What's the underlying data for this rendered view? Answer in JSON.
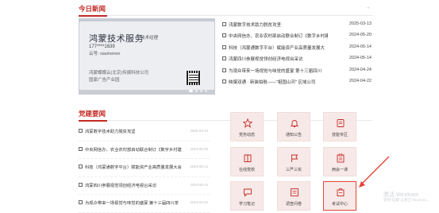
{
  "sections": {
    "news_title": "今日新闻",
    "party_title": "党建要闻",
    "more_symbol": "→"
  },
  "card": {
    "name": "鸿蒙技术服务",
    "role": "技术经理",
    "phone": "177****1639",
    "id_line": "云号: xiaoheiren",
    "company": "鸿蒙蝶蝶云(北京)传媒科技公司",
    "park": "国家广告产业园"
  },
  "news": [
    {
      "title": "鸿蒙数字技术助力脱贫攻坚",
      "date": "2025-03-13"
    },
    {
      "title": "中央网信办、农业农村部启动联合制订《数字乡村建",
      "date": "2024-05-20"
    },
    {
      "title": "科技（鸿蒙通数字平台）赋能资产业高质量发展大",
      "date": "2024-05-14"
    },
    {
      "title": "鸿蒙四川参展视觉领创经济电视台采访",
      "date": "2024-05-14"
    },
    {
      "title": "为观众带来一场视觉与味觉的盛宴 第十三届四川",
      "date": "2024-04-24"
    },
    {
      "title": "映爆双通 · 新装拍航——\"祖国山河\" 区域公司",
      "date": "2024-04-22"
    }
  ],
  "party_news": [
    {
      "title": "鸿蒙数字技术助力脱贫攻坚",
      "date": "2025-03-13"
    },
    {
      "title": "中央网信办、农业农村部启动联合制订《数字乡村建",
      "date": "2024-05-20"
    },
    {
      "title": "科技（鸿蒙通数字平台）赋能资产业高质量发展大会",
      "date": "2024-05-14"
    },
    {
      "title": "鸿蒙四川参展视觉领创经济电视台采访",
      "date": "2024-05-14"
    },
    {
      "title": "为观众带来一场视觉与味觉的盛宴 第十三届四川茶",
      "date": "2024-04-24"
    }
  ],
  "tiles": [
    {
      "label": "党务动态",
      "icon": "star-icon"
    },
    {
      "label": "通知公告",
      "icon": "bell-icon"
    },
    {
      "label": "技能专区",
      "icon": "badge-icon"
    },
    {
      "label": "在线党校",
      "icon": "book-icon"
    },
    {
      "label": "三严三实",
      "icon": "flag-icon"
    },
    {
      "label": "两会一课",
      "icon": "clipboard-icon"
    },
    {
      "label": "学习笔记",
      "icon": "chat-icon"
    },
    {
      "label": "调查问卷",
      "icon": "form-icon"
    },
    {
      "label": "考试中心",
      "icon": "exam-icon"
    }
  ],
  "watermark": {
    "line1": "激活 Windows",
    "line2": "转到\"设置\"以激活 Windows。"
  },
  "colors": {
    "accent": "#c52a25",
    "tile_bg": "#f7e9e7",
    "highlight": "#e4453a"
  }
}
